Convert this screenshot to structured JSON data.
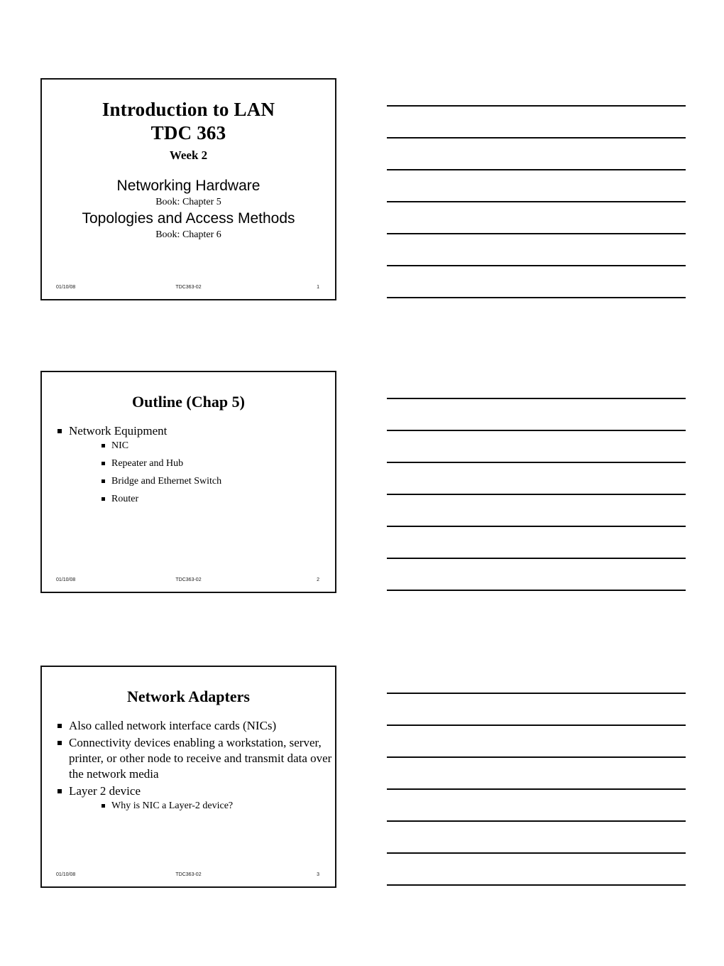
{
  "document": {
    "type": "powerpoint-handout",
    "page_background": "#ffffff",
    "line_color": "#0a0a0a"
  },
  "slides": [
    {
      "index": 1,
      "layout": "title",
      "title_line_1": "Introduction to LAN",
      "title_line_2": "TDC 363",
      "week": "Week 2",
      "sub_1_heading": "Networking Hardware",
      "sub_1_book": "Book: Chapter 5",
      "sub_2_heading": "Topologies and Access Methods",
      "sub_2_book": "Book: Chapter 6",
      "footer": {
        "date": "01/10/08",
        "code": "TDC363-02",
        "number": "1"
      },
      "notes_lines": 7
    },
    {
      "index": 2,
      "layout": "bullets",
      "title": "Outline (Chap 5)",
      "bullets": [
        {
          "text": "Network Equipment",
          "children": [
            {
              "text": "NIC"
            },
            {
              "text": "Repeater and Hub"
            },
            {
              "text": "Bridge and Ethernet Switch"
            },
            {
              "text": "Router"
            }
          ]
        }
      ],
      "footer": {
        "date": "01/10/08",
        "code": "TDC363-02",
        "number": "2"
      },
      "notes_lines": 7
    },
    {
      "index": 3,
      "layout": "bullets",
      "title": "Network Adapters",
      "bullets": [
        {
          "text": "Also called network interface cards (NICs)",
          "children": []
        },
        {
          "text": "Connectivity devices enabling a workstation, server, printer, or other node to receive and transmit data over the network media",
          "children": []
        },
        {
          "text": "Layer 2 device",
          "children": [
            {
              "text": "Why is NIC a Layer-2 device?"
            }
          ]
        }
      ],
      "footer": {
        "date": "01/10/08",
        "code": "TDC363-02",
        "number": "3"
      },
      "notes_lines": 7
    }
  ]
}
